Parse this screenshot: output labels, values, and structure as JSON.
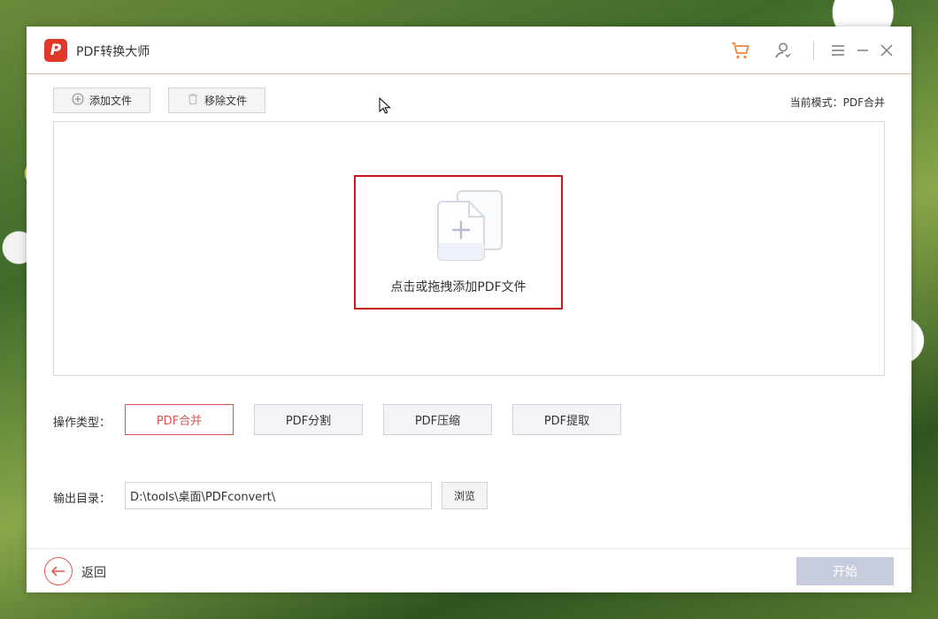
{
  "app": {
    "logo_letter": "P",
    "title": "PDF转换大师"
  },
  "titlebar_icons": [
    "cart-icon",
    "user-icon",
    "menu-icon",
    "minimize-icon",
    "close-icon"
  ],
  "toolbar": {
    "add_file": "添加文件",
    "remove_file": "移除文件",
    "mode_text": "当前模式：PDF合并"
  },
  "dropzone": {
    "prompt": "点击或拖拽添加PDF文件"
  },
  "operation": {
    "label": "操作类型：",
    "options": [
      "PDF合并",
      "PDF分割",
      "PDF压缩",
      "PDF提取"
    ],
    "selected": "PDF合并"
  },
  "output": {
    "label": "输出目录：",
    "path": "D:\\tools\\桌面\\PDFconvert\\",
    "browse": "浏览"
  },
  "footer": {
    "back": "返回",
    "start": "开始"
  },
  "colors": {
    "accent": "#e0392b",
    "highlight_border": "#c8161d",
    "start_disabled": "#c7ccdd"
  }
}
